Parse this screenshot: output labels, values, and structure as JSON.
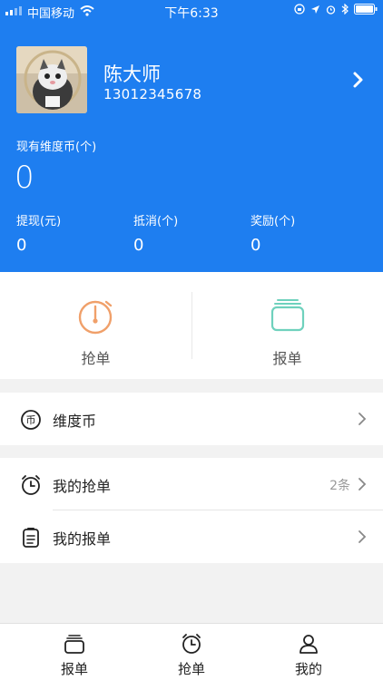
{
  "status_bar": {
    "carrier": "中国移动",
    "time": "下午6:33"
  },
  "profile": {
    "name": "陈大师",
    "phone": "13012345678"
  },
  "balance": {
    "label": "现有维度币(个)",
    "value": "0"
  },
  "stats": [
    {
      "label": "提现(元)",
      "value": "0"
    },
    {
      "label": "抵消(个)",
      "value": "0"
    },
    {
      "label": "奖励(个)",
      "value": "0"
    }
  ],
  "quick_actions": [
    {
      "label": "抢单",
      "icon": "stopwatch-icon",
      "color": "#f0a06a"
    },
    {
      "label": "报单",
      "icon": "stack-icon",
      "color": "#6fd1bd"
    }
  ],
  "menu": {
    "coin": {
      "label": "维度币",
      "icon": "coin-icon"
    },
    "my_grab": {
      "label": "我的抢单",
      "count": "2条",
      "icon": "alarm-clock-icon"
    },
    "my_report": {
      "label": "我的报单",
      "icon": "clipboard-icon"
    }
  },
  "tabs": [
    {
      "label": "报单",
      "icon": "stack-icon"
    },
    {
      "label": "抢单",
      "icon": "alarm-clock-icon"
    },
    {
      "label": "我的",
      "icon": "user-icon"
    }
  ],
  "colors": {
    "brand_blue": "#1e7ef0"
  }
}
